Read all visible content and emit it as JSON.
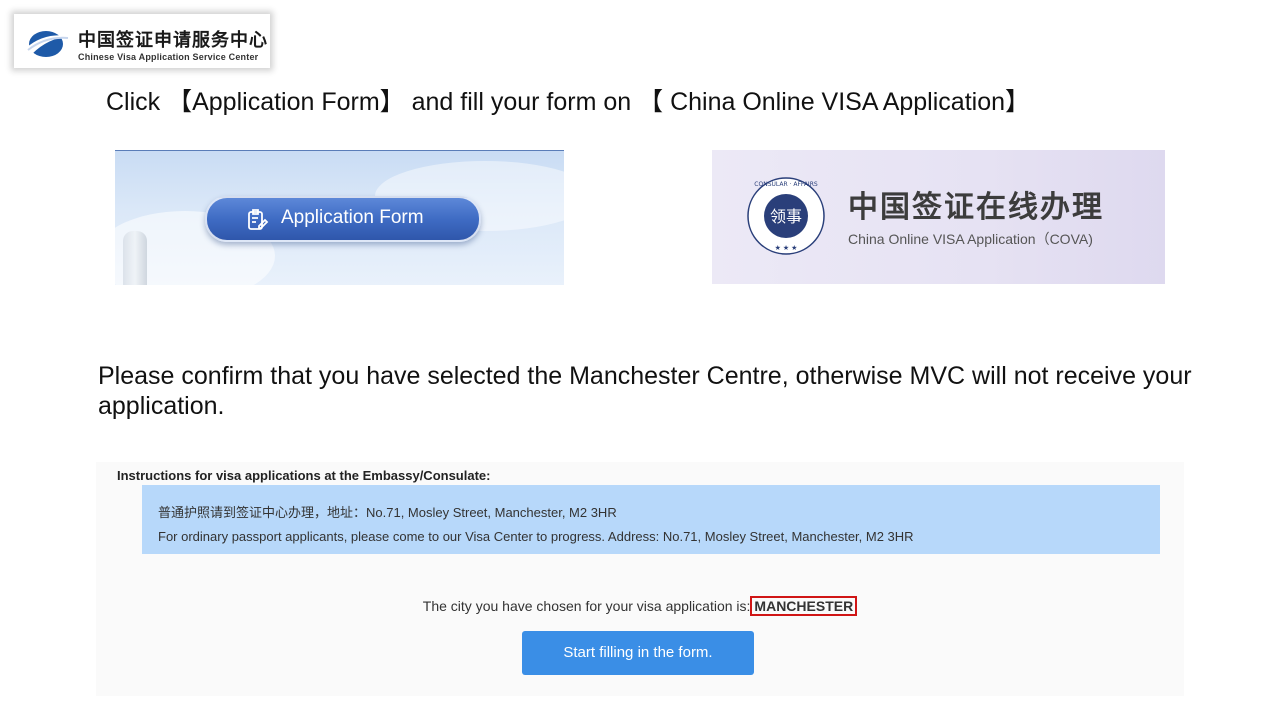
{
  "logo": {
    "cn_title": "中国签证申请服务中心",
    "en_title": "Chinese Visa Application Service Center",
    "icon": "globe-swoosh-logo"
  },
  "headline1": "Click 【Application Form】 and fill your form on 【 China Online VISA Application】",
  "appform_panel": {
    "button_label": "Application Form",
    "icon": "form-edit-icon"
  },
  "cova_panel": {
    "cn_title": "中国签证在线办理",
    "en_title": "China Online VISA Application（COVA)",
    "seal_icon": "consular-affairs-seal",
    "seal_text": "CHINA CONSULAR AFFAIRS"
  },
  "headline2": "Please confirm that you have selected the Manchester Centre, otherwise MVC will not receive your application.",
  "screenshot": {
    "instructions_title": "Instructions for visa applications at the Embassy/Consulate:",
    "instructions_cn": "普通护照请到签证中心办理，地址：No.71, Mosley Street, Manchester, M2 3HR",
    "instructions_en": "For ordinary passport applicants, please come to our Visa Center to progress. Address: No.71, Mosley Street, Manchester, M2 3HR",
    "city_prefix": "The city you have chosen for your visa application is:",
    "city_value": "MANCHESTER",
    "start_button": "Start filling in the form."
  },
  "colors": {
    "highlight_border": "#d01515",
    "start_button": "#3a8ee6",
    "instructions_box": "#b7d8fa",
    "appform_button": "#3f6cc4"
  }
}
